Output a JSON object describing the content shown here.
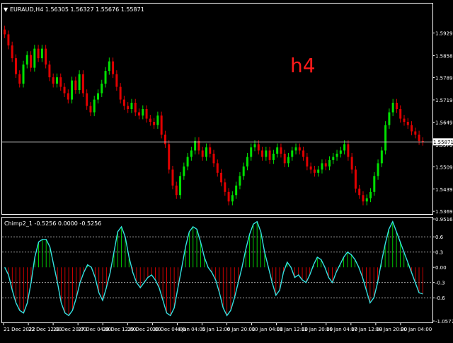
{
  "colors": {
    "background": "#000000",
    "frame": "#ffffff",
    "bull": "#00e000",
    "bear": "#e00000",
    "text": "#ffffff",
    "oscillator_line": "#33e0e0",
    "annotation": "#ff1a1a"
  },
  "chart_data": [
    {
      "type": "candlestick",
      "title": "EURAUD,H4  1.56305 1.56327 1.55676 1.55871",
      "annotation": "h4",
      "symbol": "EURAUD",
      "timeframe": "H4",
      "ohlc": {
        "open": 1.56305,
        "high": 1.56327,
        "low": 1.55676,
        "close": 1.55871
      },
      "current_price_label": "1.55871",
      "current_price": 1.55871,
      "ylim": [
        1.5365,
        1.6015
      ],
      "y_ticks": [
        1.5929,
        1.5858,
        1.5789,
        1.5719,
        1.5649,
        1.5579,
        1.5509,
        1.5439,
        1.5369
      ],
      "y_tick_labels": [
        "1.59290",
        "1.58580",
        "1.57890",
        "1.57190",
        "1.56490",
        "1.55790",
        "1.55090",
        "1.54390",
        "1.53690"
      ],
      "closes": [
        1.5925,
        1.589,
        1.585,
        1.58,
        1.577,
        1.583,
        1.586,
        1.582,
        1.588,
        1.585,
        1.588,
        1.583,
        1.579,
        1.577,
        1.579,
        1.576,
        1.574,
        1.572,
        1.578,
        1.575,
        1.58,
        1.574,
        1.57,
        1.568,
        1.572,
        1.574,
        1.577,
        1.581,
        1.584,
        1.58,
        1.576,
        1.572,
        1.57,
        1.569,
        1.571,
        1.568,
        1.567,
        1.569,
        1.566,
        1.565,
        1.564,
        1.567,
        1.561,
        1.558,
        1.55,
        1.545,
        1.542,
        1.548,
        1.551,
        1.554,
        1.556,
        1.559,
        1.556,
        1.554,
        1.557,
        1.555,
        1.552,
        1.549,
        1.546,
        1.543,
        1.54,
        1.542,
        1.545,
        1.548,
        1.551,
        1.554,
        1.557,
        1.558,
        1.556,
        1.554,
        1.556,
        1.553,
        1.555,
        1.557,
        1.555,
        1.552,
        1.554,
        1.556,
        1.557,
        1.556,
        1.554,
        1.551,
        1.55,
        1.549,
        1.55,
        1.552,
        1.551,
        1.553,
        1.554,
        1.555,
        1.556,
        1.558,
        1.554,
        1.55,
        1.544,
        1.542,
        1.54,
        1.541,
        1.543,
        1.548,
        1.552,
        1.556,
        1.564,
        1.568,
        1.571,
        1.569,
        1.566,
        1.565,
        1.564,
        1.562,
        1.561,
        1.559,
        1.55871
      ],
      "x_tick_labels": [
        "21 Dec 2022",
        "22 Dec 12:00",
        "23 Dec 20:00",
        "27 Dec 04:00",
        "28 Dec 12:00",
        "29 Dec 20:00",
        "30 Dec 04:00",
        "4 Jan 04:00",
        "5 Jan 12:00",
        "6 Jan 20:00",
        "10 Jan 04:00",
        "11 Jan 12:00",
        "12 Jan 20:00",
        "16 Jan 04:00",
        "17 Jan 12:00",
        "18 Jan 20:00",
        "20 Jan 04:00"
      ]
    },
    {
      "type": "histogram_line",
      "title": "Chimp2_1 -0.5256 0.0000 -0.5256",
      "ylim": [
        -1.0577,
        0.9516
      ],
      "y_ticks": [
        0.9516,
        0.6,
        0.3,
        0.0,
        -0.3,
        -0.6,
        -1.0577
      ],
      "y_tick_labels": [
        "0.9516",
        "0.6",
        "0.3",
        "0.00",
        "-0.3",
        "-0.6",
        "-1.0577"
      ],
      "levels": [
        0.6,
        0.3,
        -0.3,
        -0.6
      ],
      "values": [
        0.0,
        -0.15,
        -0.45,
        -0.7,
        -0.85,
        -0.9,
        -0.7,
        -0.3,
        0.2,
        0.5,
        0.55,
        0.55,
        0.4,
        0.05,
        -0.3,
        -0.7,
        -0.9,
        -0.95,
        -0.85,
        -0.6,
        -0.3,
        -0.1,
        0.05,
        0.0,
        -0.2,
        -0.5,
        -0.65,
        -0.4,
        -0.1,
        0.3,
        0.7,
        0.8,
        0.6,
        0.2,
        -0.1,
        -0.3,
        -0.4,
        -0.3,
        -0.2,
        -0.15,
        -0.25,
        -0.4,
        -0.65,
        -0.9,
        -0.95,
        -0.8,
        -0.4,
        0.0,
        0.4,
        0.7,
        0.8,
        0.75,
        0.5,
        0.2,
        0.0,
        -0.1,
        -0.25,
        -0.5,
        -0.8,
        -0.95,
        -0.85,
        -0.6,
        -0.3,
        0.0,
        0.35,
        0.65,
        0.85,
        0.9,
        0.7,
        0.3,
        0.0,
        -0.3,
        -0.55,
        -0.45,
        -0.1,
        0.1,
        0.0,
        -0.2,
        -0.15,
        -0.25,
        -0.3,
        -0.15,
        0.05,
        0.2,
        0.15,
        0.0,
        -0.2,
        -0.3,
        -0.1,
        0.05,
        0.2,
        0.3,
        0.25,
        0.15,
        0.0,
        -0.2,
        -0.45,
        -0.7,
        -0.6,
        -0.3,
        0.1,
        0.45,
        0.75,
        0.9,
        0.7,
        0.5,
        0.3,
        0.1,
        -0.1,
        -0.3,
        -0.5,
        -0.5256
      ]
    }
  ]
}
